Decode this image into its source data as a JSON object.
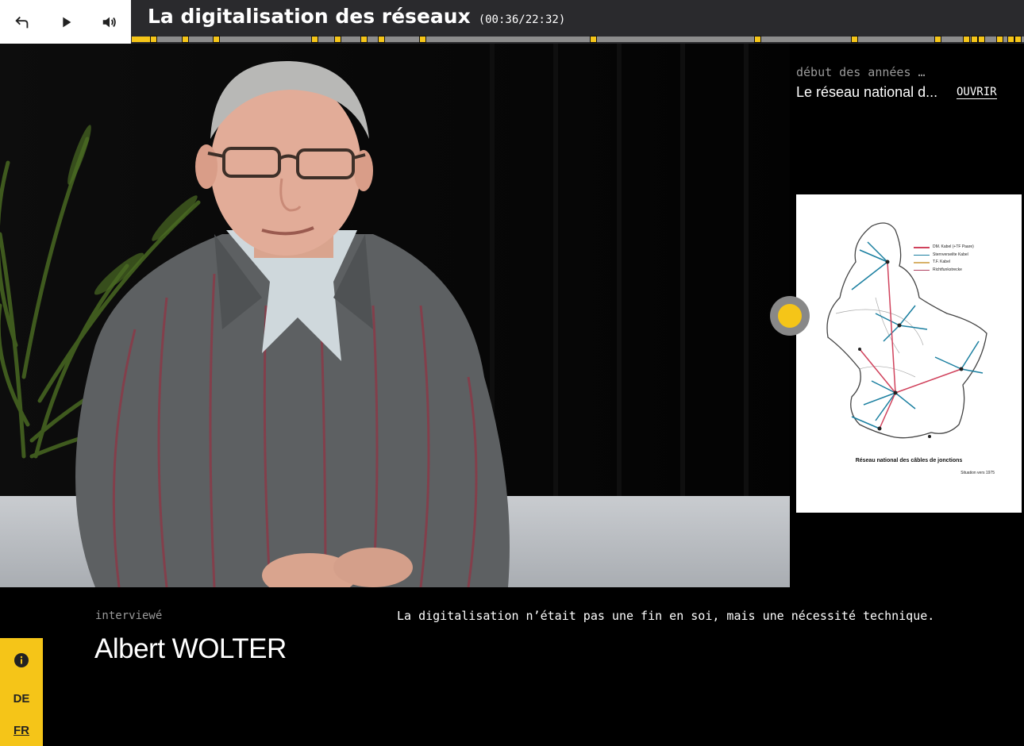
{
  "header": {
    "title": "La digitalisation des réseaux",
    "timecode": "(00:36/22:32)",
    "controls": {
      "back_icon": "return-arrow-icon",
      "play_icon": "play-icon",
      "volume_icon": "speaker-icon"
    }
  },
  "timeline": {
    "progress": 0.027,
    "chapter_markers": [
      0.024,
      0.06,
      0.094,
      0.205,
      0.23,
      0.26,
      0.279,
      0.326,
      0.517,
      0.701,
      0.81,
      0.903,
      0.935,
      0.944,
      0.952,
      0.972,
      0.985,
      0.993
    ],
    "colors": {
      "accent": "#f5c518",
      "track": "#8c8c8c"
    }
  },
  "side_panel": {
    "date": "début des années …",
    "document_title": "Le réseau national d...",
    "open_label": "OUVRIR",
    "document": {
      "legend": [
        "DM. Kabel (+TF Paare)",
        "Sternverseilte Kabel",
        "T.F. Kabel",
        "Richtfunkstrecke"
      ],
      "caption": "Réseau national des câbles de jonctions",
      "subcaption": "Situation vers 1975"
    }
  },
  "interview": {
    "role": "interviewé",
    "name": "Albert WOLTER",
    "quote": "La digitalisation n’était pas une fin en soi, mais une nécessité technique."
  },
  "language_bar": {
    "info_icon": "info-icon",
    "languages": [
      "DE",
      "FR"
    ],
    "active": "FR"
  }
}
